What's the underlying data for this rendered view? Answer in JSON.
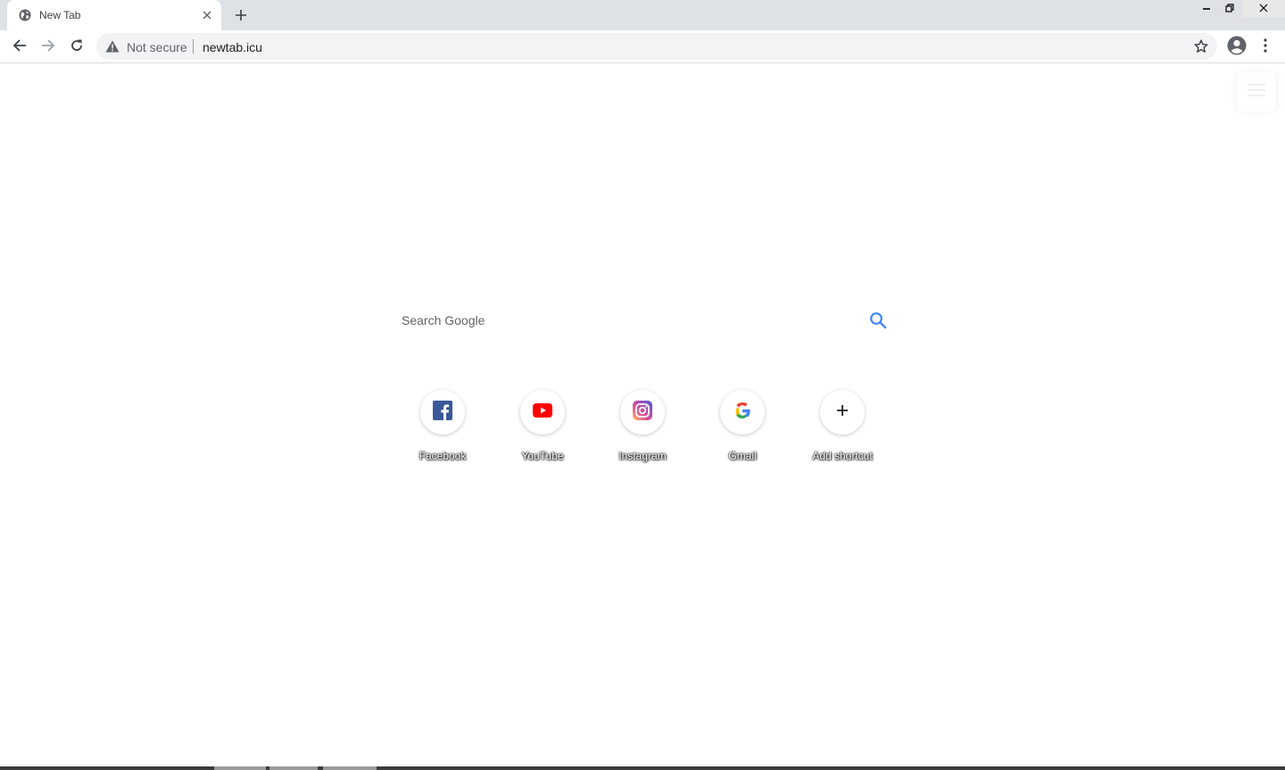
{
  "browser": {
    "tab": {
      "title": "New Tab",
      "favicon": "globe-icon"
    },
    "window_buttons": [
      "minimize-icon",
      "restore-icon",
      "close-icon"
    ]
  },
  "toolbar": {
    "security_label": "Not secure",
    "url": "newtab.icu"
  },
  "search": {
    "placeholder": "Search Google",
    "icon": "search-icon",
    "accent": "#4285f4"
  },
  "shortcuts": [
    {
      "label": "Facebook",
      "icon": "facebook-icon",
      "color": "#3b5998"
    },
    {
      "label": "YouTube",
      "icon": "youtube-icon",
      "color": "#ff0000"
    },
    {
      "label": "Instagram",
      "icon": "instagram-icon",
      "color": "#c13584"
    },
    {
      "label": "Gmail",
      "icon": "google-icon",
      "color": "#4285f4"
    },
    {
      "label": "Add shortcut",
      "icon": "plus-icon",
      "color": "#202124"
    }
  ]
}
